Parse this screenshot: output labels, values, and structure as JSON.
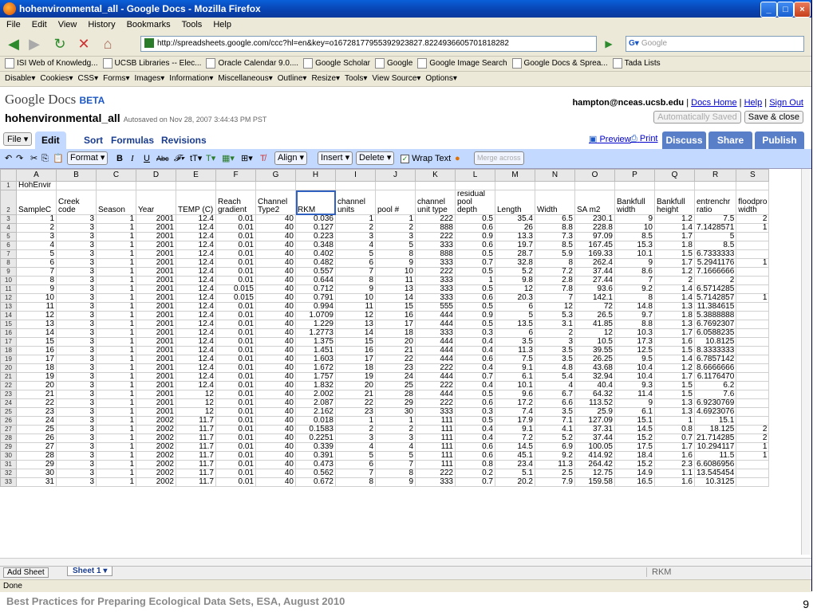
{
  "window": {
    "title": "hohenvironmental_all - Google Docs - Mozilla Firefox"
  },
  "menu": [
    "File",
    "Edit",
    "View",
    "History",
    "Bookmarks",
    "Tools",
    "Help"
  ],
  "url": "http://spreadsheets.google.com/ccc?hl=en&key=o16728177955392923827.8224936605701818282",
  "search_placeholder": "Google",
  "bookmarks": [
    "ISI Web of Knowledg...",
    "UCSB Libraries -- Elec...",
    "Oracle Calendar 9.0....",
    "Google Scholar",
    "Google",
    "Google Image Search",
    "Google Docs & Sprea...",
    "Tada Lists"
  ],
  "devtools": [
    "Disable▾",
    "Cookies▾",
    "CSS▾",
    "Forms▾",
    "Images▾",
    "Information▾",
    "Miscellaneous▾",
    "Outline▾",
    "Resize▾",
    "Tools▾",
    "View Source▾",
    "Options▾"
  ],
  "app": {
    "logo": "Google Docs",
    "logo_beta": "BETA",
    "doc_title": "hohenvironmental_all",
    "autosave": "Autosaved on Nov 28, 2007 3:44:43 PM PST",
    "user": "hampton@nceas.ucsb.edu",
    "links": [
      "Docs Home",
      "Help",
      "Sign Out"
    ],
    "auto_saved_btn": "Automatically Saved",
    "save_close_btn": "Save & close",
    "file_btn": "File ▾",
    "tabs": [
      "Edit",
      "Sort",
      "Formulas",
      "Revisions"
    ],
    "preview": "Preview",
    "print": "Print",
    "discuss": "Discuss",
    "share": "Share",
    "publish": "Publish"
  },
  "toolbar": {
    "format": "Format ▾",
    "align": "Align ▾",
    "insert": "Insert ▾",
    "delete": "Delete ▾",
    "wrap": "Wrap Text",
    "merge": "Merge across"
  },
  "sheet": {
    "columns": [
      "A",
      "B",
      "C",
      "D",
      "E",
      "F",
      "G",
      "H",
      "I",
      "J",
      "K",
      "L",
      "M",
      "N",
      "O",
      "P",
      "Q",
      "R",
      "S"
    ],
    "row1": "HohEnvir",
    "headers": [
      "SampleC",
      "Creek code",
      "Season",
      "Year",
      "TEMP (C)",
      "Reach gradient",
      "Channel Type2",
      "RKM",
      "channel units",
      "pool #",
      "channel unit type",
      "residual pool depth",
      "Length",
      "Width",
      "SA m2",
      "Bankfull width",
      "Bankfull height",
      "entrenchr ratio",
      "floodpro width"
    ],
    "rows": [
      [
        "1",
        "3",
        "1",
        "2001",
        "12.4",
        "0.01",
        "40",
        "0.036",
        "1",
        "1",
        "222",
        "0.5",
        "35.4",
        "6.5",
        "230.1",
        "9",
        "1.2",
        "7.5",
        "2"
      ],
      [
        "2",
        "3",
        "1",
        "2001",
        "12.4",
        "0.01",
        "40",
        "0.127",
        "2",
        "2",
        "888",
        "0.6",
        "26",
        "8.8",
        "228.8",
        "10",
        "1.4",
        "7.1428571",
        "1"
      ],
      [
        "3",
        "3",
        "1",
        "2001",
        "12.4",
        "0.01",
        "40",
        "0.223",
        "3",
        "3",
        "222",
        "0.9",
        "13.3",
        "7.3",
        "97.09",
        "8.5",
        "1.7",
        "5",
        ""
      ],
      [
        "4",
        "3",
        "1",
        "2001",
        "12.4",
        "0.01",
        "40",
        "0.348",
        "4",
        "5",
        "333",
        "0.6",
        "19.7",
        "8.5",
        "167.45",
        "15.3",
        "1.8",
        "8.5",
        ""
      ],
      [
        "5",
        "3",
        "1",
        "2001",
        "12.4",
        "0.01",
        "40",
        "0.402",
        "5",
        "8",
        "888",
        "0.5",
        "28.7",
        "5.9",
        "169.33",
        "10.1",
        "1.5",
        "6.7333333",
        ""
      ],
      [
        "6",
        "3",
        "1",
        "2001",
        "12.4",
        "0.01",
        "40",
        "0.482",
        "6",
        "9",
        "333",
        "0.7",
        "32.8",
        "8",
        "262.4",
        "9",
        "1.7",
        "5.2941176",
        "1"
      ],
      [
        "7",
        "3",
        "1",
        "2001",
        "12.4",
        "0.01",
        "40",
        "0.557",
        "7",
        "10",
        "222",
        "0.5",
        "5.2",
        "7.2",
        "37.44",
        "8.6",
        "1.2",
        "7.1666666",
        ""
      ],
      [
        "8",
        "3",
        "1",
        "2001",
        "12.4",
        "0.01",
        "40",
        "0.644",
        "8",
        "11",
        "333",
        "1",
        "9.8",
        "2.8",
        "27.44",
        "7",
        "2",
        "2",
        ""
      ],
      [
        "9",
        "3",
        "1",
        "2001",
        "12.4",
        "0.015",
        "40",
        "0.712",
        "9",
        "13",
        "333",
        "0.5",
        "12",
        "7.8",
        "93.6",
        "9.2",
        "1.4",
        "6.5714285",
        ""
      ],
      [
        "10",
        "3",
        "1",
        "2001",
        "12.4",
        "0.015",
        "40",
        "0.791",
        "10",
        "14",
        "333",
        "0.6",
        "20.3",
        "7",
        "142.1",
        "8",
        "1.4",
        "5.7142857",
        "1"
      ],
      [
        "11",
        "3",
        "1",
        "2001",
        "12.4",
        "0.01",
        "40",
        "0.994",
        "11",
        "15",
        "555",
        "0.5",
        "6",
        "12",
        "72",
        "14.8",
        "1.3",
        "11.384615",
        ""
      ],
      [
        "12",
        "3",
        "1",
        "2001",
        "12.4",
        "0.01",
        "40",
        "1.0709",
        "12",
        "16",
        "444",
        "0.9",
        "5",
        "5.3",
        "26.5",
        "9.7",
        "1.8",
        "5.3888888",
        ""
      ],
      [
        "13",
        "3",
        "1",
        "2001",
        "12.4",
        "0.01",
        "40",
        "1.229",
        "13",
        "17",
        "444",
        "0.5",
        "13.5",
        "3.1",
        "41.85",
        "8.8",
        "1.3",
        "6.7692307",
        ""
      ],
      [
        "14",
        "3",
        "1",
        "2001",
        "12.4",
        "0.01",
        "40",
        "1.2773",
        "14",
        "18",
        "333",
        "0.3",
        "6",
        "2",
        "12",
        "10.3",
        "1.7",
        "6.0588235",
        ""
      ],
      [
        "15",
        "3",
        "1",
        "2001",
        "12.4",
        "0.01",
        "40",
        "1.375",
        "15",
        "20",
        "444",
        "0.4",
        "3.5",
        "3",
        "10.5",
        "17.3",
        "1.6",
        "10.8125",
        ""
      ],
      [
        "16",
        "3",
        "1",
        "2001",
        "12.4",
        "0.01",
        "40",
        "1.451",
        "16",
        "21",
        "444",
        "0.4",
        "11.3",
        "3.5",
        "39.55",
        "12.5",
        "1.5",
        "8.3333333",
        ""
      ],
      [
        "17",
        "3",
        "1",
        "2001",
        "12.4",
        "0.01",
        "40",
        "1.603",
        "17",
        "22",
        "444",
        "0.6",
        "7.5",
        "3.5",
        "26.25",
        "9.5",
        "1.4",
        "6.7857142",
        ""
      ],
      [
        "18",
        "3",
        "1",
        "2001",
        "12.4",
        "0.01",
        "40",
        "1.672",
        "18",
        "23",
        "222",
        "0.4",
        "9.1",
        "4.8",
        "43.68",
        "10.4",
        "1.2",
        "8.6666666",
        ""
      ],
      [
        "19",
        "3",
        "1",
        "2001",
        "12.4",
        "0.01",
        "40",
        "1.757",
        "19",
        "24",
        "444",
        "0.7",
        "6.1",
        "5.4",
        "32.94",
        "10.4",
        "1.7",
        "6.1176470",
        ""
      ],
      [
        "20",
        "3",
        "1",
        "2001",
        "12.4",
        "0.01",
        "40",
        "1.832",
        "20",
        "25",
        "222",
        "0.4",
        "10.1",
        "4",
        "40.4",
        "9.3",
        "1.5",
        "6.2",
        ""
      ],
      [
        "21",
        "3",
        "1",
        "2001",
        "12",
        "0.01",
        "40",
        "2.002",
        "21",
        "28",
        "444",
        "0.5",
        "9.6",
        "6.7",
        "64.32",
        "11.4",
        "1.5",
        "7.6",
        ""
      ],
      [
        "22",
        "3",
        "1",
        "2001",
        "12",
        "0.01",
        "40",
        "2.087",
        "22",
        "29",
        "222",
        "0.6",
        "17.2",
        "6.6",
        "113.52",
        "9",
        "1.3",
        "6.9230769",
        ""
      ],
      [
        "23",
        "3",
        "1",
        "2001",
        "12",
        "0.01",
        "40",
        "2.162",
        "23",
        "30",
        "333",
        "0.3",
        "7.4",
        "3.5",
        "25.9",
        "6.1",
        "1.3",
        "4.6923076",
        ""
      ],
      [
        "24",
        "3",
        "1",
        "2002",
        "11.7",
        "0.01",
        "40",
        "0.018",
        "1",
        "1",
        "111",
        "0.5",
        "17.9",
        "7.1",
        "127.09",
        "15.1",
        "1",
        "15.1",
        ""
      ],
      [
        "25",
        "3",
        "1",
        "2002",
        "11.7",
        "0.01",
        "40",
        "0.1583",
        "2",
        "2",
        "111",
        "0.4",
        "9.1",
        "4.1",
        "37.31",
        "14.5",
        "0.8",
        "18.125",
        "2"
      ],
      [
        "26",
        "3",
        "1",
        "2002",
        "11.7",
        "0.01",
        "40",
        "0.2251",
        "3",
        "3",
        "111",
        "0.4",
        "7.2",
        "5.2",
        "37.44",
        "15.2",
        "0.7",
        "21.714285",
        "2"
      ],
      [
        "27",
        "3",
        "1",
        "2002",
        "11.7",
        "0.01",
        "40",
        "0.339",
        "4",
        "4",
        "111",
        "0.6",
        "14.5",
        "6.9",
        "100.05",
        "17.5",
        "1.7",
        "10.294117",
        "1"
      ],
      [
        "28",
        "3",
        "1",
        "2002",
        "11.7",
        "0.01",
        "40",
        "0.391",
        "5",
        "5",
        "111",
        "0.6",
        "45.1",
        "9.2",
        "414.92",
        "18.4",
        "1.6",
        "11.5",
        "1"
      ],
      [
        "29",
        "3",
        "1",
        "2002",
        "11.7",
        "0.01",
        "40",
        "0.473",
        "6",
        "7",
        "111",
        "0.8",
        "23.4",
        "11.3",
        "264.42",
        "15.2",
        "2.3",
        "6.6086956",
        ""
      ],
      [
        "30",
        "3",
        "1",
        "2002",
        "11.7",
        "0.01",
        "40",
        "0.562",
        "7",
        "8",
        "222",
        "0.2",
        "5.1",
        "2.5",
        "12.75",
        "14.9",
        "1.1",
        "13.545454",
        ""
      ],
      [
        "31",
        "3",
        "1",
        "2002",
        "11.7",
        "0.01",
        "40",
        "0.672",
        "8",
        "9",
        "333",
        "0.7",
        "20.2",
        "7.9",
        "159.58",
        "16.5",
        "1.6",
        "10.3125",
        ""
      ]
    ]
  },
  "sheetbar": {
    "add": "Add Sheet",
    "tab": "Sheet 1 ▾",
    "cellref": "RKM"
  },
  "status": "Done",
  "footer": "Best Practices for Preparing Ecological Data Sets, ESA, August 2010",
  "page_number": "9"
}
